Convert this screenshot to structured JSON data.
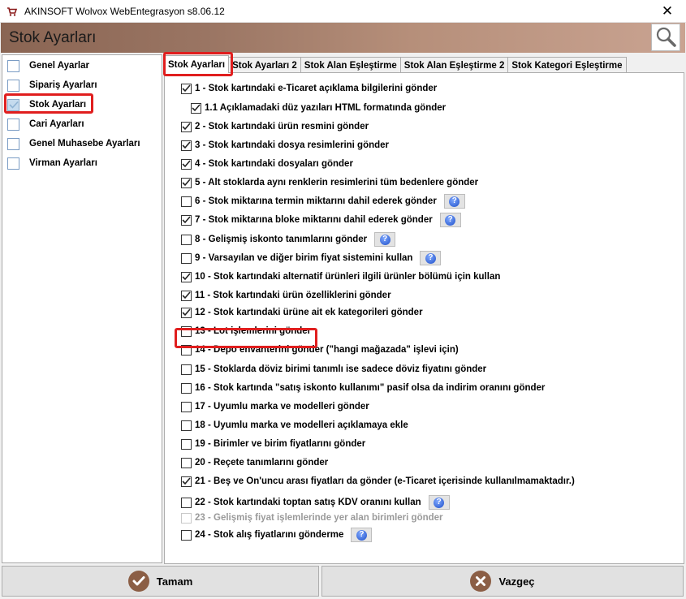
{
  "window": {
    "title": "AKINSOFT Wolvox WebEntegrasyon s8.06.12",
    "close_glyph": "✕"
  },
  "banner": {
    "title": "Stok Ayarları",
    "search_icon": "search-icon"
  },
  "sidebar": {
    "items": [
      {
        "label": "Genel Ayarlar",
        "checked": false
      },
      {
        "label": "Sipariş Ayarları",
        "checked": false
      },
      {
        "label": "Stok Ayarları",
        "checked": true,
        "selected": true
      },
      {
        "label": "Cari Ayarları",
        "checked": false
      },
      {
        "label": "Genel Muhasebe Ayarları",
        "checked": false
      },
      {
        "label": "Virman Ayarları",
        "checked": false
      }
    ]
  },
  "tabs": [
    {
      "label": "Stok Ayarları",
      "active": true
    },
    {
      "label": "Stok Ayarları 2",
      "active": false
    },
    {
      "label": "Stok Alan Eşleştirme",
      "active": false
    },
    {
      "label": "Stok Alan Eşleştirme 2",
      "active": false
    },
    {
      "label": "Stok Kategori Eşleştirme",
      "active": false
    }
  ],
  "options": [
    {
      "label": "1 - Stok kartındaki e-Ticaret açıklama bilgilerini gönder",
      "checked": true
    },
    {
      "label": "1.1 Açıklamadaki düz yazıları HTML formatında gönder",
      "checked": true
    },
    {
      "label": "2 - Stok kartındaki ürün resmini gönder",
      "checked": true
    },
    {
      "label": "3 - Stok kartındaki dosya resimlerini gönder",
      "checked": true
    },
    {
      "label": "4 - Stok kartındaki dosyaları gönder",
      "checked": true
    },
    {
      "label": "5 - Alt stoklarda aynı renklerin resimlerini tüm bedenlere gönder",
      "checked": true
    },
    {
      "label": "6 - Stok miktarına termin miktarını dahil ederek gönder",
      "checked": false
    },
    {
      "label": "7 - Stok miktarına bloke miktarını dahil ederek gönder",
      "checked": true
    },
    {
      "label": "8 - Gelişmiş iskonto tanımlarını gönder",
      "checked": false
    },
    {
      "label": "9 - Varsayılan ve diğer birim fiyat sistemini kullan",
      "checked": false
    },
    {
      "label": "10 - Stok kartındaki alternatif ürünleri ilgili ürünler bölümü için kullan",
      "checked": true
    },
    {
      "label": "11 - Stok kartındaki ürün özelliklerini gönder",
      "checked": true
    },
    {
      "label": "12 - Stok kartındaki ürüne ait ek kategorileri gönder",
      "checked": true
    },
    {
      "label": "13 - Lot işlemlerini gönder",
      "checked": false
    },
    {
      "label": "14 - Depo envanterini gönder (\"hangi mağazada\" işlevi için)",
      "checked": false
    },
    {
      "label": "15 - Stoklarda döviz birimi tanımlı ise sadece döviz fiyatını gönder",
      "checked": false
    },
    {
      "label": "16 - Stok kartında \"satış iskonto kullanımı\" pasif olsa da indirim oranını gönder",
      "checked": false
    },
    {
      "label": "17 - Uyumlu marka ve modelleri gönder",
      "checked": false
    },
    {
      "label": "18 - Uyumlu marka ve modelleri açıklamaya ekle",
      "checked": false
    },
    {
      "label": "19 - Birimler ve birim fiyatlarını gönder",
      "checked": false
    },
    {
      "label": "20 - Reçete tanımlarını gönder",
      "checked": false
    },
    {
      "label": "21 - Beş ve On'uncu arası fiyatları da gönder (e-Ticaret içerisinde kullanılmamaktadır.)",
      "checked": true
    },
    {
      "label": "22 - Stok kartındaki toptan satış KDV oranını kullan",
      "checked": false
    },
    {
      "label": "23 - Gelişmiş fiyat işlemlerinde yer alan birimleri gönder",
      "checked": false,
      "disabled": true
    },
    {
      "label": "24 - Stok alış fiyatlarını gönderme",
      "checked": false
    }
  ],
  "help_glyph": "?",
  "buttons": {
    "ok": "Tamam",
    "cancel": "Vazgeç"
  }
}
